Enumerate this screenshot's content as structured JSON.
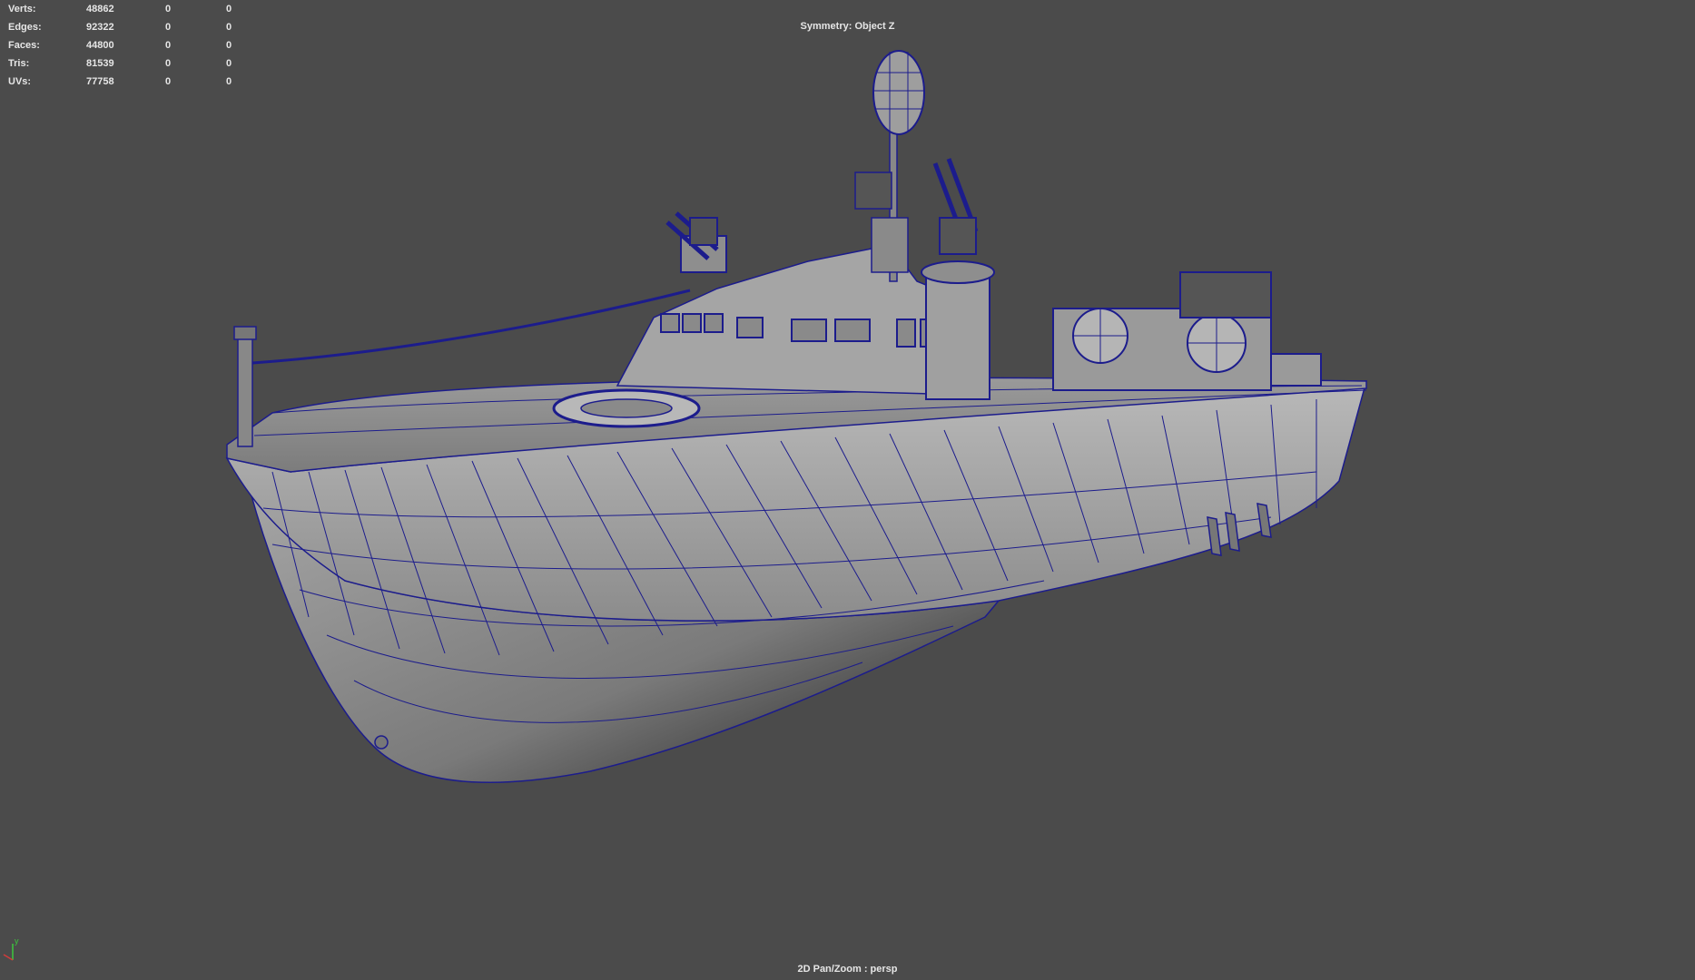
{
  "hud": {
    "rows": [
      {
        "label": "Verts:",
        "value": "48862",
        "a": "0",
        "b": "0"
      },
      {
        "label": "Edges:",
        "value": "92322",
        "a": "0",
        "b": "0"
      },
      {
        "label": "Faces:",
        "value": "44800",
        "a": "0",
        "b": "0"
      },
      {
        "label": "Tris:",
        "value": "81539",
        "a": "0",
        "b": "0"
      },
      {
        "label": "UVs:",
        "value": "77758",
        "a": "0",
        "b": "0"
      }
    ]
  },
  "symmetry_label": "Symmetry: Object Z",
  "camera_label": "2D Pan/Zoom : persp",
  "axis": {
    "y_label": "y"
  },
  "colors": {
    "background": "#4b4b4b",
    "wireframe": "#1c1c8c",
    "mesh_light": "#b4b4b4",
    "mesh_dark": "#6e6e6e",
    "hud_text": "#e6e6e6",
    "axis_x": "#d23c3c",
    "axis_y": "#3cc83c"
  }
}
